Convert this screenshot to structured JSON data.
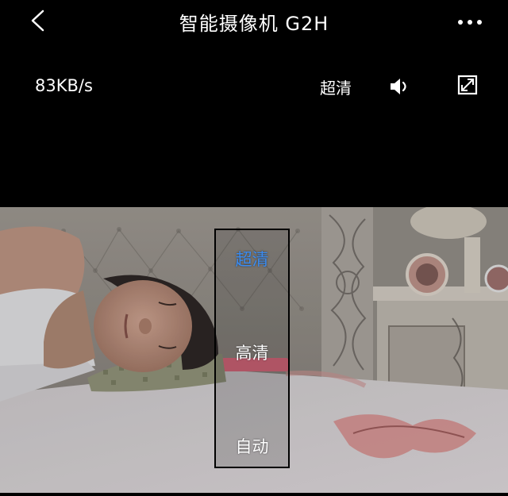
{
  "header": {
    "title": "智能摄像机 G2H",
    "back_icon": "chevron-left-icon",
    "more_icon": "more-dots-icon"
  },
  "toolbar": {
    "speed": "83KB/s",
    "quality_label": "超清",
    "sound_icon": "speaker-icon",
    "fullscreen_icon": "fullscreen-icon"
  },
  "quality_menu": {
    "options": [
      "超清",
      "高清",
      "自动"
    ],
    "selected": "超清",
    "selected_color": "#3b8cf0"
  }
}
